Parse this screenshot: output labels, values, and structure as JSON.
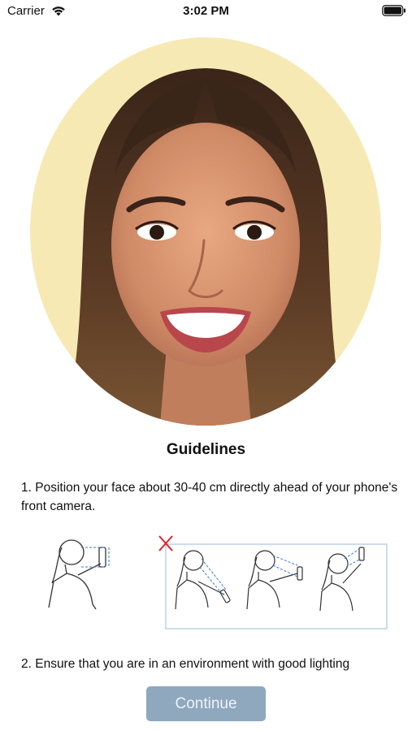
{
  "status_bar": {
    "carrier": "Carrier",
    "time": "3:02 PM",
    "icons": [
      "wifi-icon",
      "battery-icon"
    ]
  },
  "portrait": {
    "description_icon": "face-photo",
    "background_color": "#f7e9b4"
  },
  "guidelines": {
    "title": "Guidelines",
    "step1": "1. Position your face about 30-40 cm directly ahead of your phone's front camera.",
    "step2": "2. Ensure that you are in an environment with good lighting"
  },
  "illustration": {
    "correct_icon": "person-holding-phone-icon",
    "incorrect_icon": "red-x-icon",
    "incorrect_color": "#e0202a",
    "guide_line_color": "#3a78d8"
  },
  "actions": {
    "continue_label": "Continue",
    "button_color": "#8fa8be"
  }
}
